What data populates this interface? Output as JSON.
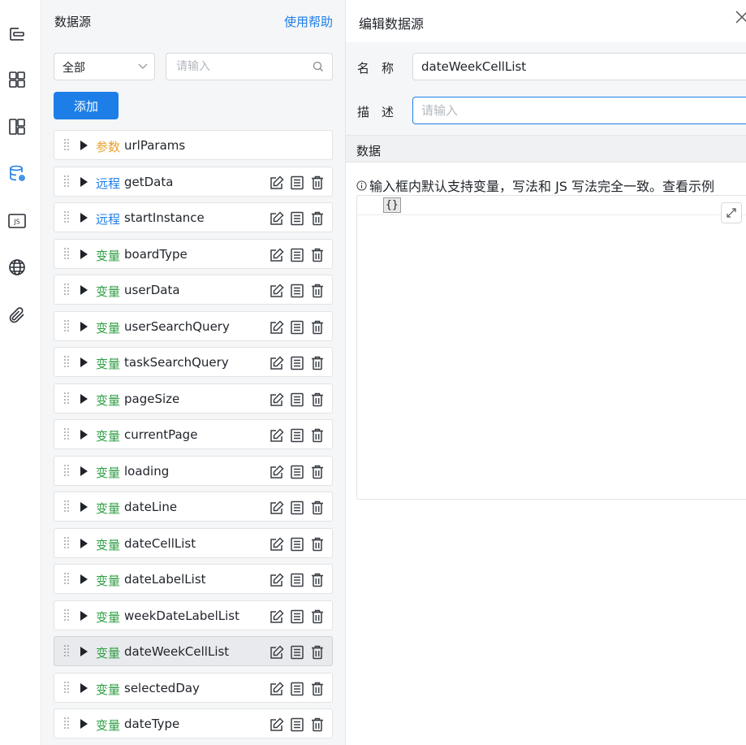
{
  "sidebar": {
    "icons": [
      "outline-tree-icon",
      "components-grid-icon",
      "layout-icon",
      "datasource-icon",
      "js-icon",
      "globe-icon",
      "attachment-icon"
    ],
    "active": "datasource-icon"
  },
  "datasource_panel": {
    "title": "数据源",
    "help_link": "使用帮助",
    "filter_select": {
      "value": "全部"
    },
    "search": {
      "placeholder": "请输入",
      "value": ""
    },
    "add_button": "添加",
    "items": [
      {
        "tag": "参数",
        "tag_color": "#e9a12a",
        "name": "urlParams",
        "actions": false
      },
      {
        "tag": "远程",
        "tag_color": "#1d7ee8",
        "name": "getData",
        "actions": true
      },
      {
        "tag": "远程",
        "tag_color": "#1d7ee8",
        "name": "startInstance",
        "actions": true
      },
      {
        "tag": "变量",
        "tag_color": "#2f9e44",
        "name": "boardType",
        "actions": true
      },
      {
        "tag": "变量",
        "tag_color": "#2f9e44",
        "name": "userData",
        "actions": true
      },
      {
        "tag": "变量",
        "tag_color": "#2f9e44",
        "name": "userSearchQuery",
        "actions": true
      },
      {
        "tag": "变量",
        "tag_color": "#2f9e44",
        "name": "taskSearchQuery",
        "actions": true
      },
      {
        "tag": "变量",
        "tag_color": "#2f9e44",
        "name": "pageSize",
        "actions": true
      },
      {
        "tag": "变量",
        "tag_color": "#2f9e44",
        "name": "currentPage",
        "actions": true
      },
      {
        "tag": "变量",
        "tag_color": "#2f9e44",
        "name": "loading",
        "actions": true
      },
      {
        "tag": "变量",
        "tag_color": "#2f9e44",
        "name": "dateLine",
        "actions": true
      },
      {
        "tag": "变量",
        "tag_color": "#2f9e44",
        "name": "dateCellList",
        "actions": true
      },
      {
        "tag": "变量",
        "tag_color": "#2f9e44",
        "name": "dateLabelList",
        "actions": true
      },
      {
        "tag": "变量",
        "tag_color": "#2f9e44",
        "name": "weekDateLabelList",
        "actions": true
      },
      {
        "tag": "变量",
        "tag_color": "#2f9e44",
        "name": "dateWeekCellList",
        "actions": true,
        "selected": true
      },
      {
        "tag": "变量",
        "tag_color": "#2f9e44",
        "name": "selectedDay",
        "actions": true
      },
      {
        "tag": "变量",
        "tag_color": "#2f9e44",
        "name": "dateType",
        "actions": true
      }
    ]
  },
  "editor": {
    "title": "编辑数据源",
    "name_label": "名　称",
    "name_value": "dateWeekCellList",
    "desc_label": "描　述",
    "desc_placeholder": "请输入",
    "desc_value": "",
    "section_label": "数据",
    "hint": "输入框内默认支持变量，写法和 JS 写法完全一致。查看示例",
    "code": "{}"
  }
}
